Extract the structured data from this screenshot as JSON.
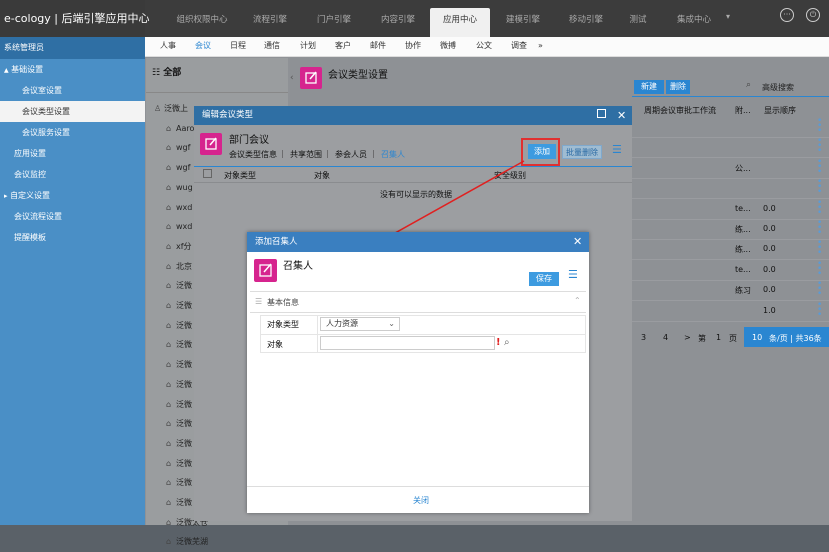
{
  "app": {
    "title": "e-cology | 后端引擎应用中心"
  },
  "topnav": {
    "items": [
      "组织权限中心",
      "流程引擎",
      "门户引擎",
      "内容引擎",
      "应用中心",
      "建模引擎",
      "移动引擎",
      "测试",
      "集成中心"
    ]
  },
  "sidebar": {
    "title": "系统管理员",
    "items": [
      {
        "label": "基础设置",
        "expander": "▲"
      },
      {
        "label": "会议室设置"
      },
      {
        "label": "会议类型设置"
      },
      {
        "label": "会议服务设置"
      },
      {
        "label": "应用设置"
      },
      {
        "label": "会议监控"
      },
      {
        "label": "自定义设置",
        "expander": "▸"
      },
      {
        "label": "会议流程设置"
      },
      {
        "label": "提醒模板"
      }
    ]
  },
  "subnav": {
    "items": [
      "人事",
      "会议",
      "日程",
      "通信",
      "计划",
      "客户",
      "邮件",
      "协作",
      "微搏",
      "公文",
      "调查"
    ],
    "more": "»"
  },
  "tree": {
    "header": "全部",
    "items": [
      "泛微上",
      "Aaro",
      "wgf",
      "wgf",
      "wug",
      "wxd",
      "wxd",
      "xf分",
      "北京",
      "泛微",
      "泛微",
      "泛微",
      "泛微",
      "泛微",
      "泛微",
      "泛微",
      "泛微",
      "泛微",
      "泛微",
      "泛微",
      "泛微",
      "泛微太仓",
      "泛微芜湖"
    ]
  },
  "page": {
    "title": "会议类型设置",
    "new_btn": "新建",
    "del_btn": "删除",
    "adv_search": "高级搜索",
    "headers": [
      "周期会议审批工作流",
      "附...",
      "显示顺序"
    ],
    "rows": [
      {
        "a": "",
        "b": ""
      },
      {
        "a": "",
        "b": ""
      },
      {
        "a": "公...",
        "b": ""
      },
      {
        "a": "",
        "b": ""
      },
      {
        "a": "te...",
        "b": "0.0"
      },
      {
        "a": "练...",
        "b": "0.0"
      },
      {
        "a": "练...",
        "b": "0.0"
      },
      {
        "a": "te...",
        "b": "0.0"
      },
      {
        "a": "练习",
        "b": "0.0"
      },
      {
        "a": "",
        "b": "1.0"
      }
    ],
    "pager": {
      "p3": "3",
      "p4": "4",
      "next": ">",
      "di": "第",
      "cur": "1",
      "ye": "页",
      "per": "10",
      "per_suffix": "条/页 | 共36条"
    }
  },
  "dlg1": {
    "title": "编辑会议类型",
    "name": "部门会议",
    "tabs": [
      "会议类型信息",
      "共享范围",
      "参会人员",
      "召集人"
    ],
    "add_btn": "添加",
    "batch_del": "批量删除",
    "headers": [
      "对象类型",
      "对象",
      "安全级别"
    ],
    "empty": "没有可以显示的数据"
  },
  "dlg2": {
    "title": "添加召集人",
    "name": "召集人",
    "save": "保存",
    "section": "基本信息",
    "type_label": "对象类型",
    "type_value": "人力资源",
    "obj_label": "对象",
    "required_mark": "!",
    "close": "关闭"
  },
  "colors": {
    "accent": "#2a86d1",
    "pink": "#d6248e",
    "required": "#e02020",
    "highlight": "#e03030"
  }
}
